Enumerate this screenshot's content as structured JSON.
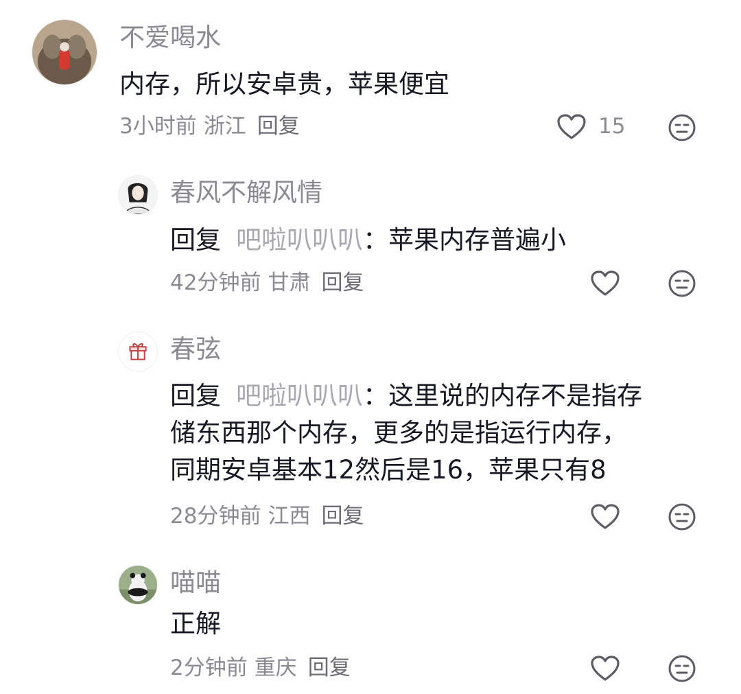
{
  "comments": [
    {
      "username": "不爱喝水",
      "text": "内存，所以安卓贵，苹果便宜",
      "time": "3小时前",
      "location": "浙江",
      "reply_label": "回复",
      "like_count": "15"
    },
    {
      "username": "春风不解风情",
      "reply_prefix": "回复",
      "reply_target": "吧啦叭叭叭",
      "colon": "：",
      "text": "苹果内存普遍小",
      "time": "42分钟前",
      "location": "甘肃",
      "reply_label": "回复"
    },
    {
      "username": "春弦",
      "reply_prefix": "回复",
      "reply_target": "吧啦叭叭叭",
      "colon": "：",
      "text_line1": "这里说的内存不是指存",
      "text_line2": "储东西那个内存，更多的是指运行内存，",
      "text_line3": "同期安卓基本12然后是16，苹果只有8",
      "time": "28分钟前",
      "location": "江西",
      "reply_label": "回复"
    },
    {
      "username": "喵喵",
      "text": "正解",
      "time": "2分钟前",
      "location": "重庆",
      "reply_label": "回复"
    }
  ],
  "colors": {
    "text_primary": "#161823",
    "text_secondary": "#8a8b91",
    "reply_target": "#a8a9ae",
    "icon": "#5c5d63"
  },
  "icons": [
    "heart-outline-icon",
    "neutral-face-icon",
    "gift-icon"
  ]
}
